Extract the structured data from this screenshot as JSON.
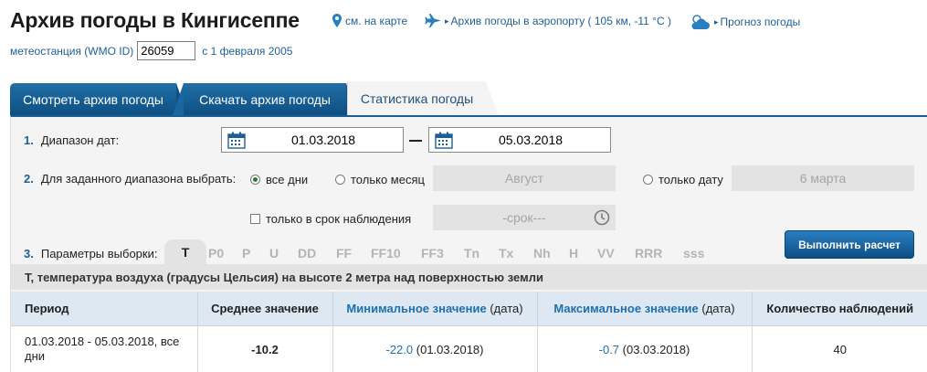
{
  "header": {
    "title": "Архив погоды в Кингисеппе",
    "map_link": "см. на карте",
    "airport_link": "Архив погоды в аэропорту ( 105 км, -11 °C )",
    "forecast_link": "Прогноз погоды"
  },
  "station": {
    "label": "метеостанция (WMO ID)",
    "wmo_id": "26059",
    "since": "с 1 февраля 2005"
  },
  "tabs": [
    {
      "label": "Смотреть архив погоды"
    },
    {
      "label": "Скачать архив погоды"
    },
    {
      "label": "Статистика погоды"
    }
  ],
  "form": {
    "row1": {
      "num": "1.",
      "label": "Диапазон дат:",
      "date_from": "01.03.2018",
      "date_to": "05.03.2018"
    },
    "row2": {
      "num": "2.",
      "label": "Для заданного диапазона выбрать:",
      "opt_all": "все дни",
      "opt_month": "только месяц",
      "month_value": "Август",
      "opt_date": "только дату",
      "date_value": "6 марта",
      "opt_obs": "только в срок наблюдения",
      "obs_value": "-срок---"
    },
    "row3": {
      "num": "3.",
      "label": "Параметры выборки:",
      "active_param": "T",
      "params": [
        "P0",
        "P",
        "U",
        "DD",
        "FF",
        "FF10",
        "FF3",
        "Tn",
        "Tx",
        "Nh",
        "H",
        "VV",
        "RRR",
        "sss"
      ]
    },
    "calc_button": "Выполнить расчет"
  },
  "description": "T, температура воздуха (градусы Цельсия) на высоте 2 метра над поверхностью земли",
  "results": {
    "headers": {
      "period": "Период",
      "avg": "Среднее значение",
      "min": "Минимальное значение",
      "min_suffix": "(дата)",
      "max": "Максимальное значение",
      "max_suffix": "(дата)",
      "count": "Количество наблюдений"
    },
    "row": {
      "period": "01.03.2018 - 05.03.2018, все дни",
      "avg": "-10.2",
      "min_value": "-22.0",
      "min_date": "(01.03.2018)",
      "max_value": "-0.7",
      "max_date": "(03.03.2018)",
      "count": "40"
    }
  },
  "colors": {
    "accent_blue": "#1f5f99",
    "tab_dark": "#0f4f82",
    "panel_bg": "#f4f4f4",
    "field_gray": "#e3e3e3"
  }
}
